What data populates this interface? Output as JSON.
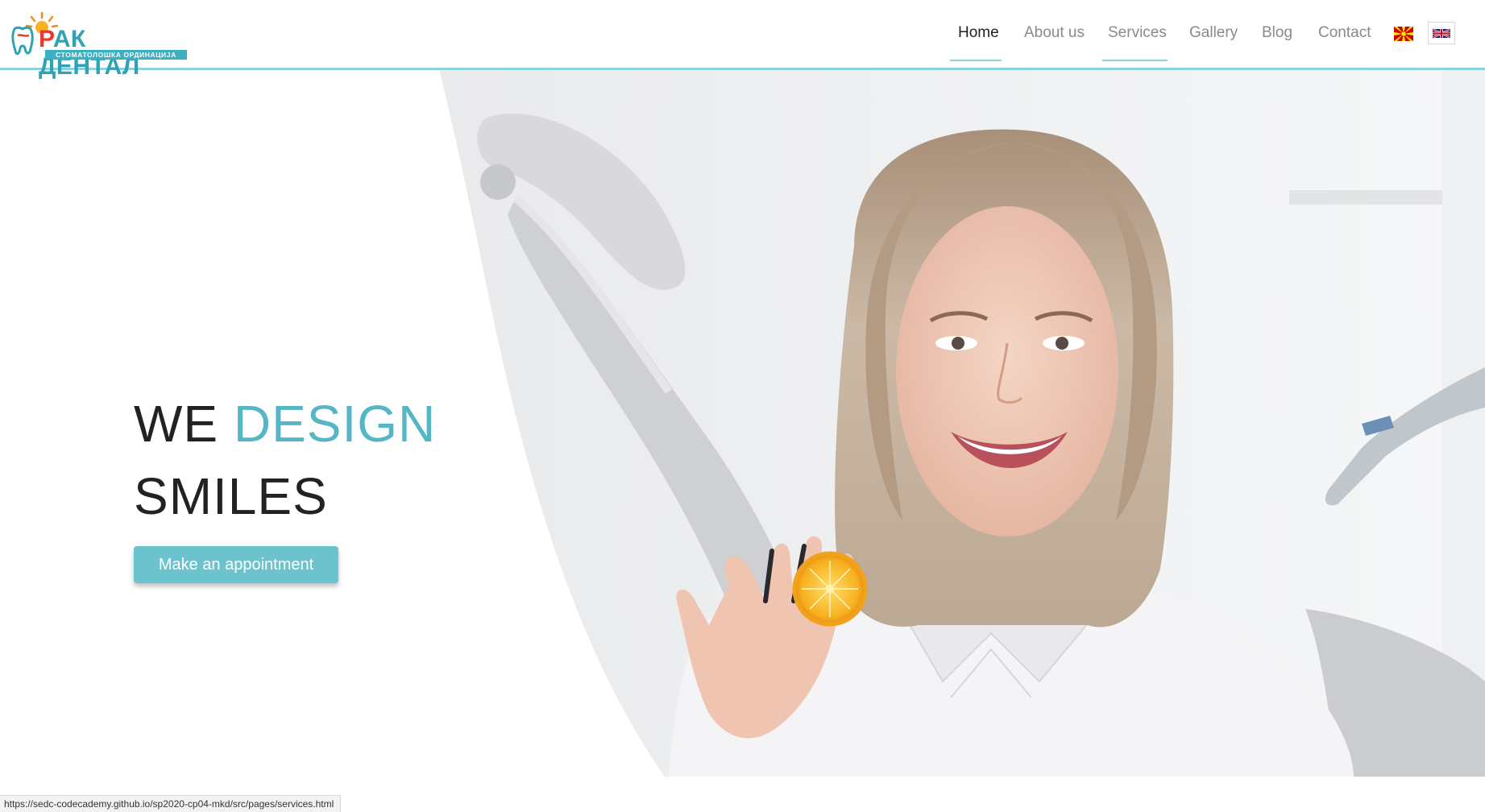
{
  "brand": {
    "logo_main_first": "Р",
    "logo_main_rest": "АК ДЕНТАЛ",
    "logo_sub": "СТОМАТОЛОШКА ОРДИНАЦИЈА"
  },
  "nav": {
    "items": [
      {
        "label": "Home",
        "active": true
      },
      {
        "label": "About us",
        "active": false
      },
      {
        "label": "Services",
        "active": false
      },
      {
        "label": "Gallery",
        "active": false
      },
      {
        "label": "Blog",
        "active": false
      },
      {
        "label": "Contact",
        "active": false
      }
    ],
    "languages": [
      "mk-flag-icon",
      "uk-flag-icon"
    ]
  },
  "hero": {
    "line1_plain": "WE ",
    "line1_accent": "DESIGN",
    "line2": "SMILES",
    "cta_label": "Make an appointment"
  },
  "status": {
    "url": "https://sedc-codecademy.github.io/sp2020-cp04-mkd/src/pages/services.html"
  },
  "colors": {
    "accent": "#55b6c6",
    "button": "#6cc3cd",
    "header_border": "#8fd3d9",
    "logo_red": "#e63b2e",
    "logo_teal": "#2fa3b4"
  }
}
